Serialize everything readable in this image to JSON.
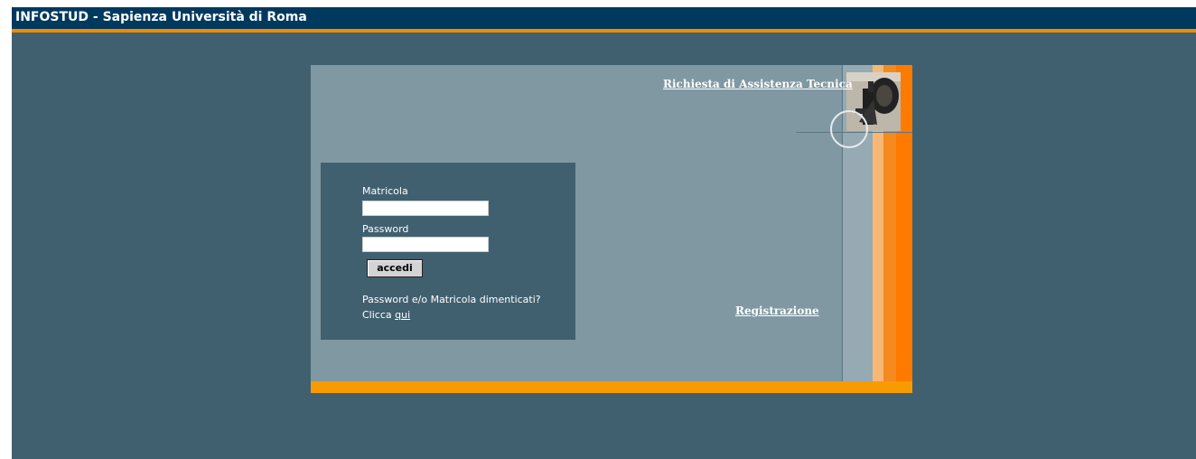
{
  "app": {
    "title": "INFOSTUD - Sapienza Università di Roma"
  },
  "colors": {
    "header": "#00395e",
    "accent": "#f08a00",
    "background": "#41606f",
    "panel": "#8098a2"
  },
  "links": {
    "assistance": "Richiesta di Assistenza Tecnica",
    "registration": "Registrazione"
  },
  "login": {
    "matricola_label": "Matricola",
    "matricola_value": "",
    "password_label": "Password",
    "password_value": "",
    "submit_label": "accedi",
    "forgot_text": "Password e/o Matricola dimenticati?",
    "click_prefix": "Clicca",
    "click_link": "qui"
  },
  "icons": {
    "photo": "press-photo-icon",
    "circle": "circle-decoration-icon"
  }
}
